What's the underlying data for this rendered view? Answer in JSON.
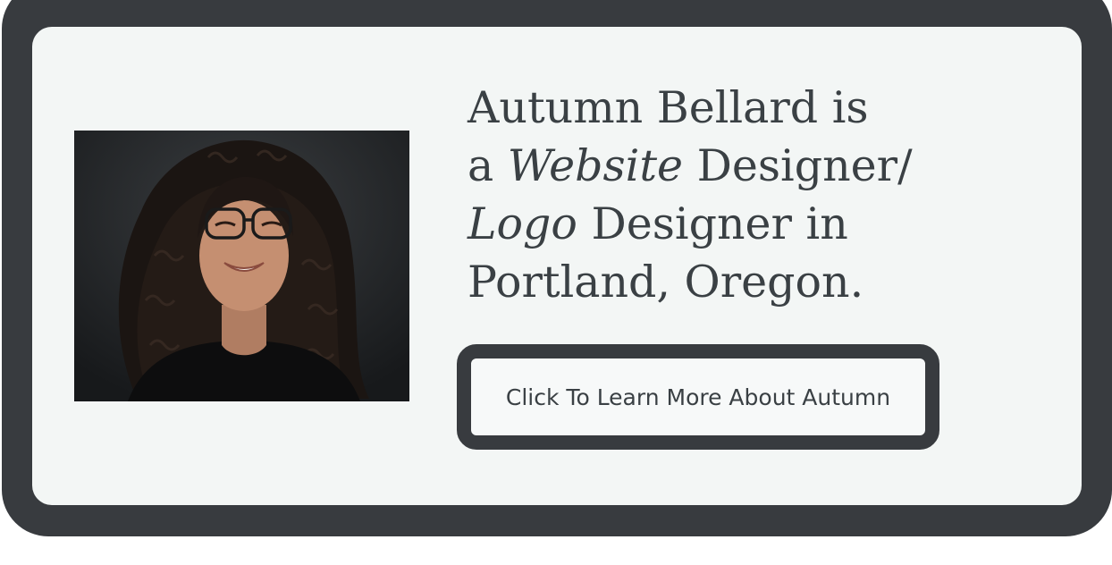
{
  "hero": {
    "headline": {
      "line1": "Autumn Bellard is",
      "line2_prefix": "a ",
      "line2_em": "Website",
      "line2_suffix": " Designer/",
      "line3_em": "Logo",
      "line3_suffix": " Designer in",
      "line4": "Portland, Oregon."
    },
    "photo": {
      "alt": "Autumn Bellard"
    },
    "cta": {
      "label": "Click To Learn More About Autumn"
    }
  },
  "colors": {
    "frame": "#383b3f",
    "card": "#f3f6f5",
    "text": "#3a4044"
  }
}
